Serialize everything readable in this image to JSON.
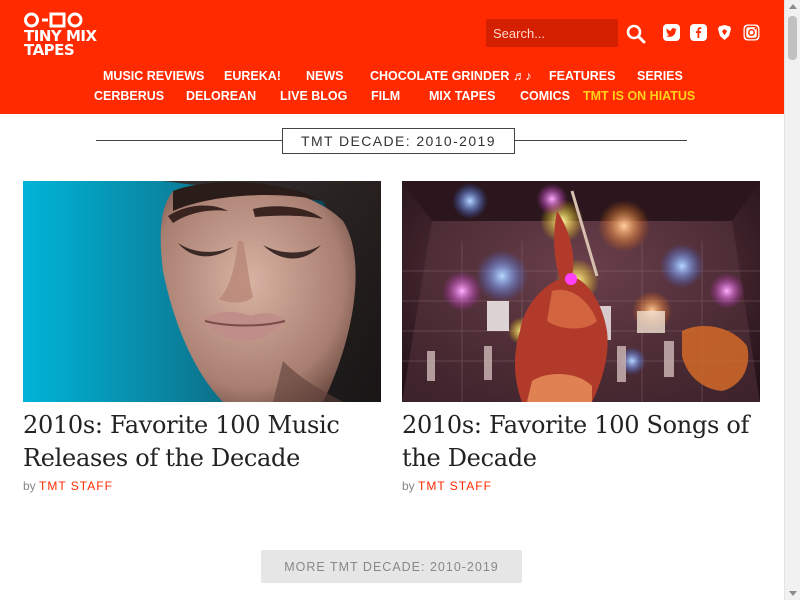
{
  "logo": {
    "line1": "TINY MIX",
    "line2": "TAPES"
  },
  "search": {
    "placeholder": "Search..."
  },
  "social": [
    "twitter-icon",
    "facebook-icon",
    "brave-icon",
    "instagram-icon"
  ],
  "nav": {
    "row1": [
      "MUSIC REVIEWS",
      "EUREKA!",
      "NEWS",
      "CHOCOLATE GRINDER ♬♪",
      "FEATURES",
      "SERIES"
    ],
    "row2": [
      "CERBERUS",
      "DELOREAN",
      "LIVE BLOG",
      "FILM",
      "MIX TAPES",
      "COMICS",
      "TMT IS ON HIATUS"
    ]
  },
  "section": {
    "title": "TMT DECADE: 2010-2019"
  },
  "cards": [
    {
      "title": "2010s: Favorite 100 Music Releases of the Decade",
      "by": "by",
      "author": "TMT STAFF"
    },
    {
      "title": "2010s: Favorite 100 Songs of the Decade",
      "by": "by",
      "author": "TMT STAFF"
    }
  ],
  "more_button": {
    "label": "MORE TMT DECADE: 2010-2019"
  },
  "colors": {
    "brand": "#ff2a00",
    "hiatus": "#ffd21a",
    "search_bg": "#d42000"
  }
}
